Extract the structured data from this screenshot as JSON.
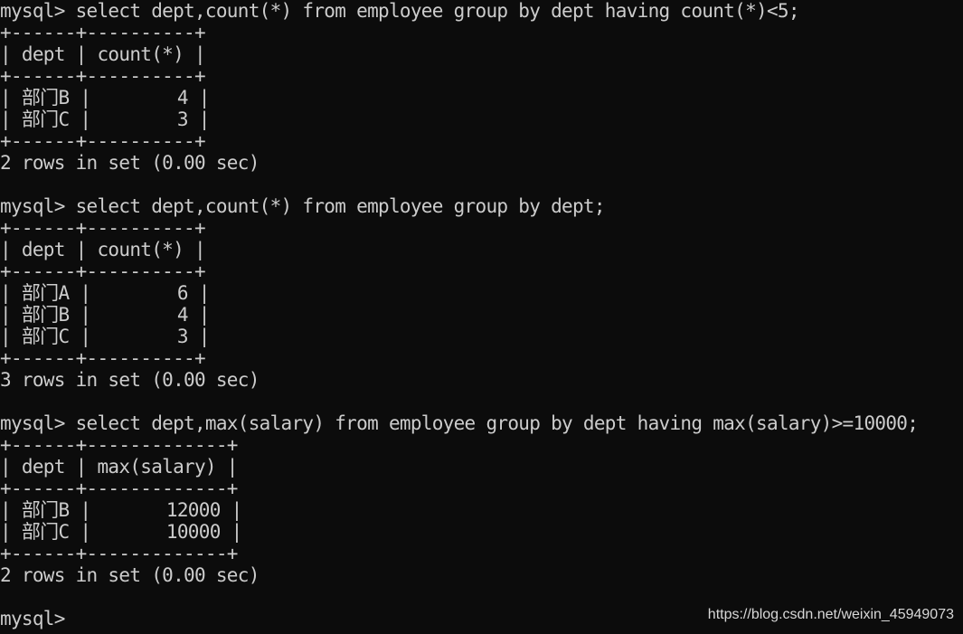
{
  "terminal": {
    "blocks": [
      {
        "lines": [
          "mysql> select dept,count(*) from employee group by dept having count(*)<5;",
          "+------+----------+",
          "| dept | count(*) |",
          "+------+----------+",
          "| 部门B |        4 |",
          "| 部门C |        3 |",
          "+------+----------+",
          "2 rows in set (0.00 sec)",
          ""
        ]
      },
      {
        "lines": [
          "mysql> select dept,count(*) from employee group by dept;",
          "+------+----------+",
          "| dept | count(*) |",
          "+------+----------+",
          "| 部门A |        6 |",
          "| 部门B |        4 |",
          "| 部门C |        3 |",
          "+------+----------+",
          "3 rows in set (0.00 sec)",
          ""
        ]
      },
      {
        "lines": [
          "mysql> select dept,max(salary) from employee group by dept having max(salary)>=10000;",
          "+------+-------------+",
          "| dept | max(salary) |",
          "+------+-------------+",
          "| 部门B |       12000 |",
          "| 部门C |       10000 |",
          "+------+-------------+",
          "2 rows in set (0.00 sec)",
          ""
        ]
      },
      {
        "lines": [
          "mysql>"
        ]
      }
    ],
    "watermark": "https://blog.csdn.net/weixin_45949073"
  }
}
